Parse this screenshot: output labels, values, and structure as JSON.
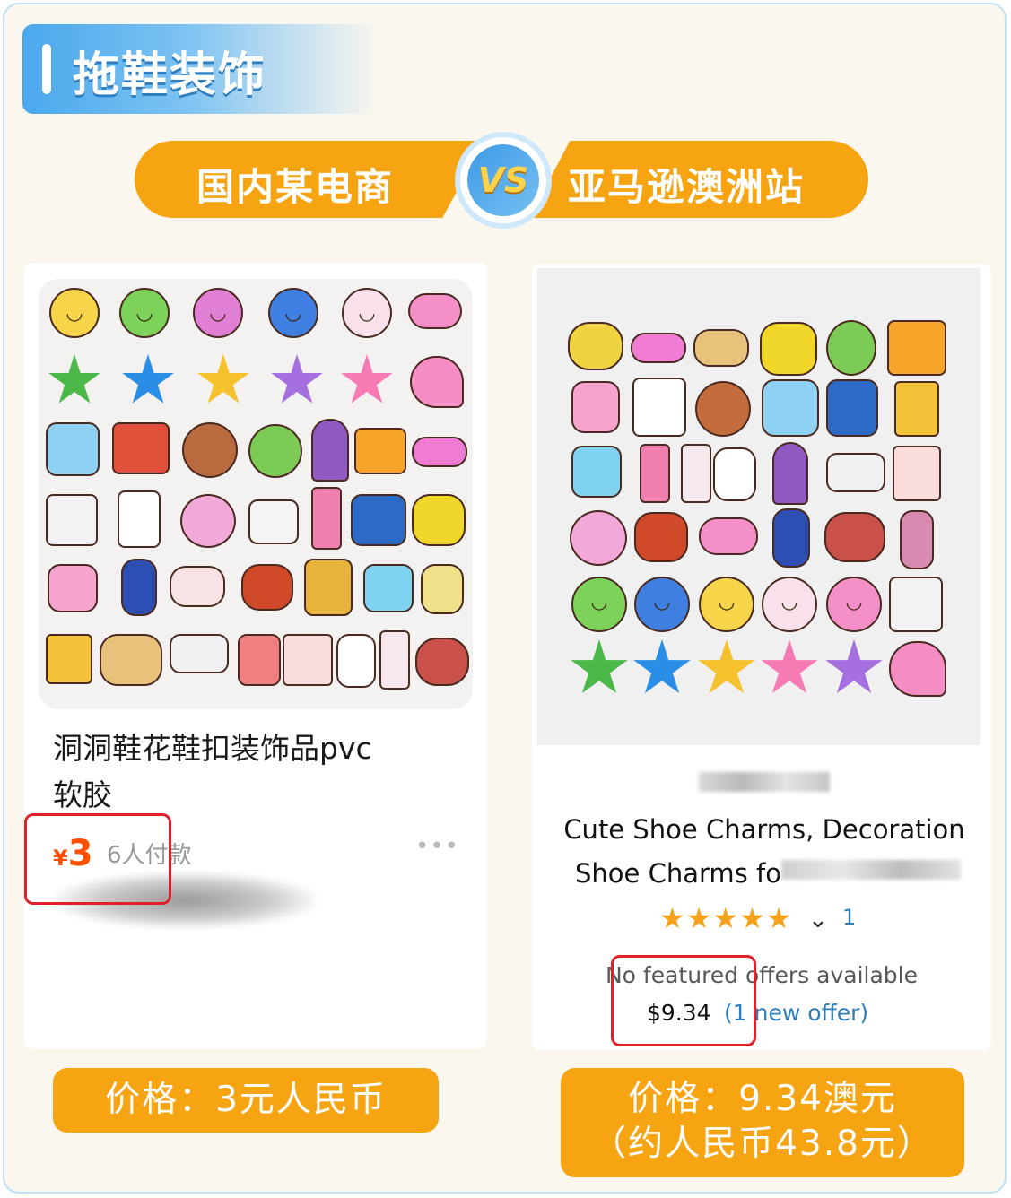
{
  "section": {
    "title": "拖鞋装饰"
  },
  "comparison": {
    "left_label": "国内某电商",
    "vs_label": "VS",
    "right_label": "亚马逊澳洲站"
  },
  "left_product": {
    "title_line1": "洞洞鞋花鞋扣装饰品pvc",
    "title_line2": "软胶",
    "currency_symbol": "¥",
    "price": "3",
    "paid_count": "6人付款",
    "more": "•••"
  },
  "right_product": {
    "title_line1": "Cute Shoe Charms, Decoration",
    "title_line2": "Shoe Charms fo",
    "stars": "★★★★★",
    "rating_count": "1",
    "no_offers": "No featured offers available",
    "price": "$9.34",
    "offer_link": "(1 new offer)"
  },
  "price_summary": {
    "left": "价格：3元人民币",
    "right_line1": "价格：9.34澳元",
    "right_line2": "（约人民币43.8元）"
  },
  "colors": {
    "accent_orange": "#f7a413",
    "header_blue": "#4aa8ec",
    "price_red": "#ff5000",
    "highlight_box": "#e0202a"
  }
}
